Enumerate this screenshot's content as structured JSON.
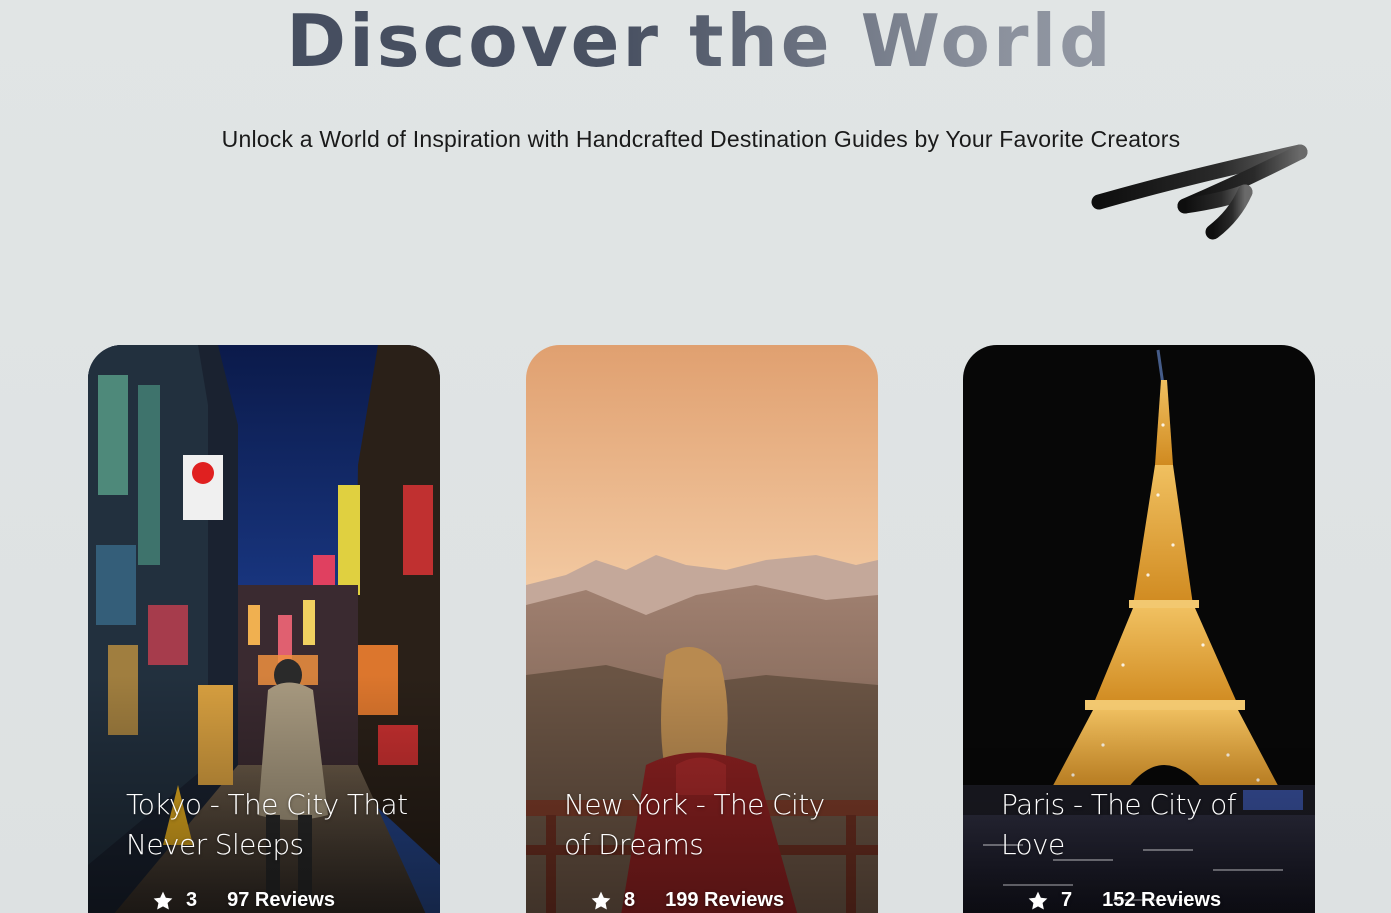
{
  "hero": {
    "title": "Discover the World",
    "subtitle": "Unlock a World of Inspiration with Handcrafted Destination Guides by Your Favorite Creators"
  },
  "decoration": {
    "icon": "hand-drawn-arrow-icon"
  },
  "cards": [
    {
      "title": "Tokyo - The City That Never Sleeps",
      "rating": "3",
      "reviews": "97 Reviews",
      "image": "tokyo-street-night",
      "icon": "star-icon"
    },
    {
      "title": "New York - The City of Dreams",
      "rating": "8",
      "reviews": "199 Reviews",
      "image": "woman-mountain-sunset",
      "icon": "star-icon"
    },
    {
      "title": "Paris - The City of Love",
      "rating": "7",
      "reviews": "152 Reviews",
      "image": "eiffel-tower-night",
      "icon": "star-icon"
    }
  ],
  "colors": {
    "background": "#e0e4e4",
    "title_dark": "#414a5c",
    "title_light": "#a4a8b2",
    "card_text": "#ffffff"
  }
}
